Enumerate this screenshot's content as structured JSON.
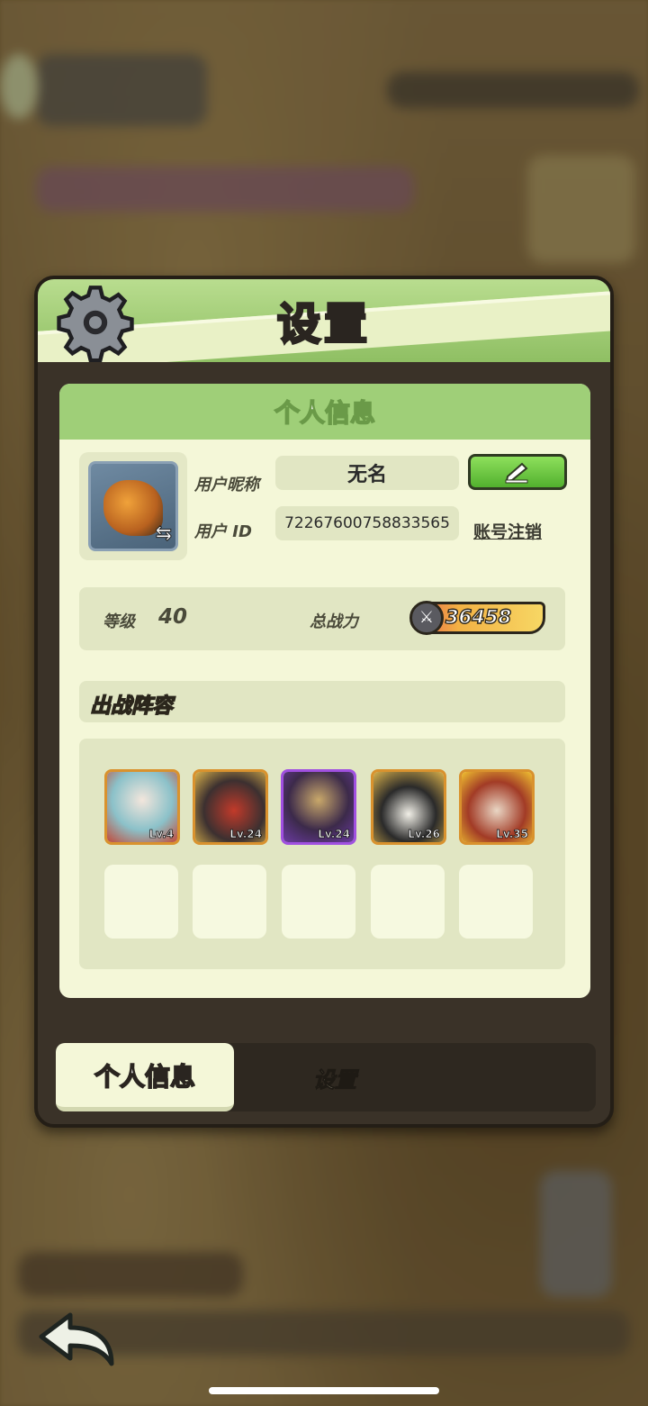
{
  "panel": {
    "title": "设置"
  },
  "card": {
    "title": "个人信息",
    "nickname_label": "用户昵称",
    "nickname": "无名",
    "userid_label": "用户  ID",
    "userid": "72267600758833565",
    "deregister_link": "账号注销",
    "level_label": "等级",
    "level": "40",
    "power_label": "总战力",
    "power": "36458",
    "lineup_title": "出战阵容"
  },
  "heroes": [
    {
      "lv": "Lv.4"
    },
    {
      "lv": "Lv.24"
    },
    {
      "lv": "Lv.24"
    },
    {
      "lv": "Lv.26"
    },
    {
      "lv": "Lv.35"
    }
  ],
  "tabs": {
    "personal": "个人信息",
    "settings": "设置"
  },
  "colors": {
    "header_green": "#9fcf78",
    "card_bg": "#f4f7d8",
    "edit_button": "#52b02e"
  },
  "icons": {
    "gear": "gear-icon",
    "pencil": "pencil-icon",
    "swap": "swap-icon",
    "swords": "swords-icon",
    "back": "back-arrow-icon"
  }
}
